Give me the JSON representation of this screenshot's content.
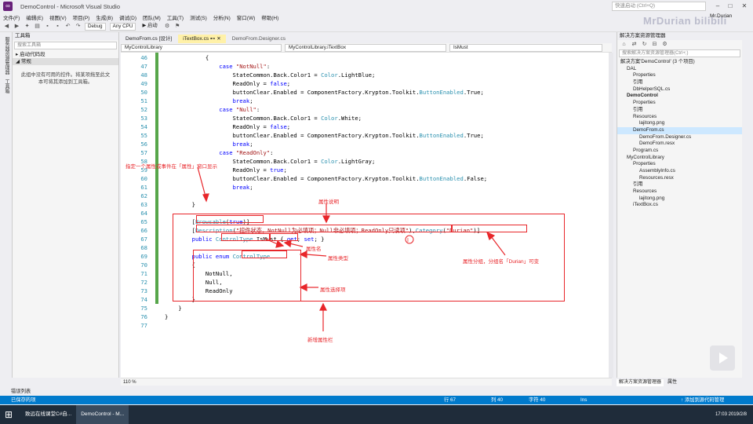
{
  "window": {
    "title": "DemoControl - Microsoft Visual Studio",
    "quick_launch_placeholder": "快速启动 (Ctrl+Q)",
    "user": "Mr.Durian",
    "watermark": "MrDurian bilibili"
  },
  "menu": [
    "文件(F)",
    "编辑(E)",
    "视图(V)",
    "项目(P)",
    "生成(B)",
    "调试(D)",
    "团队(M)",
    "工具(T)",
    "测试(S)",
    "分析(N)",
    "窗口(W)",
    "帮助(H)"
  ],
  "toolbar": {
    "config": "Debug",
    "platform": "Any CPU",
    "start_label": "▶ 启动"
  },
  "left_strip": [
    "服务器资源管理器",
    "工具箱"
  ],
  "toolbox": {
    "title": "工具箱",
    "search_placeholder": "搜索工具箱",
    "groups": [
      "启动代码段",
      "常规"
    ],
    "empty_message": "此组中没有可用的控件。将某项拖至此文本可将其添加到工具箱。"
  },
  "editor": {
    "tabs": [
      "DemoFrom.cs [设计]",
      "iTextBox.cs",
      "DemoFrom.Designer.cs"
    ],
    "active_tab_index": 1,
    "nav": [
      "MyControlLibrary",
      "MyControlLibrary.iTextBox",
      "IsMust"
    ],
    "zoom": "110 %",
    "line_numbers": [
      "46",
      "47",
      "48",
      "49",
      "50",
      "51",
      "52",
      "53",
      "54",
      "55",
      "56",
      "57",
      "58",
      "59",
      "60",
      "61",
      "62",
      "63",
      "64",
      "65",
      "66",
      "67",
      "68",
      "69",
      "70",
      "71",
      "72",
      "73",
      "74",
      "75",
      "76",
      "77"
    ],
    "code": [
      "            {",
      "                case \"NotNull\":",
      "                    StateCommon.Back.Color1 = Color.LightBlue;",
      "                    ReadOnly = false;",
      "                    buttonClear.Enabled = ComponentFactory.Krypton.Toolkit.ButtonEnabled.True;",
      "                    break;",
      "                case \"Null\":",
      "                    StateCommon.Back.Color1 = Color.White;",
      "                    ReadOnly = false;",
      "                    buttonClear.Enabled = ComponentFactory.Krypton.Toolkit.ButtonEnabled.True;",
      "                    break;",
      "                case \"ReadOnly\":",
      "                    StateCommon.Back.Color1 = Color.LightGray;",
      "                    ReadOnly = true;",
      "                    buttonClear.Enabled = ComponentFactory.Krypton.Toolkit.ButtonEnabled.False;",
      "                    break;",
      "            }",
      "        }",
      "",
      "        [Browsable(true)]",
      "        [Description(\"控件状态，NotNull为必填项；Null非必填项；ReadOnly只读项\"),Category(\"Durian\")]",
      "        public ControlType IsMust { get; set; }",
      "",
      "        public enum ControlType",
      "        {",
      "            NotNull,",
      "            Null,",
      "            ReadOnly",
      "        }",
      "    }",
      "}",
      ""
    ]
  },
  "annotations": {
    "browsable": "指定一个属性或事件在「属性」窗口显示",
    "description": "属性说明",
    "name": "属性名",
    "type": "属性类型",
    "category": "属性分组，分组名「Durian」可变",
    "options": "属性选择项",
    "new_bar": "新增属性栏"
  },
  "solution": {
    "title": "解决方案资源管理器",
    "search_placeholder": "搜索解决方案资源管理器(Ctrl+;)",
    "items": [
      {
        "text": "解决方案'DemoControl' (3 个项目)",
        "indent": 0,
        "bold": false
      },
      {
        "text": "DAL",
        "indent": 1,
        "bold": false
      },
      {
        "text": "Properties",
        "indent": 2,
        "bold": false
      },
      {
        "text": "引用",
        "indent": 2,
        "bold": false
      },
      {
        "text": "DbHelperSQL.cs",
        "indent": 2,
        "bold": false
      },
      {
        "text": "DemoControl",
        "indent": 1,
        "bold": true
      },
      {
        "text": "Properties",
        "indent": 2,
        "bold": false
      },
      {
        "text": "引用",
        "indent": 2,
        "bold": false
      },
      {
        "text": "Resources",
        "indent": 2,
        "bold": false
      },
      {
        "text": "lajitong.png",
        "indent": 3,
        "bold": false
      },
      {
        "text": "DemoFrom.cs",
        "indent": 2,
        "bold": false,
        "selected": true
      },
      {
        "text": "DemoFrom.Designer.cs",
        "indent": 3,
        "bold": false
      },
      {
        "text": "DemoFrom.resx",
        "indent": 3,
        "bold": false
      },
      {
        "text": "Program.cs",
        "indent": 2,
        "bold": false
      },
      {
        "text": "MyControlLibrary",
        "indent": 1,
        "bold": false
      },
      {
        "text": "Properties",
        "indent": 2,
        "bold": false
      },
      {
        "text": "AssemblyInfo.cs",
        "indent": 3,
        "bold": false
      },
      {
        "text": "Resources.resx",
        "indent": 3,
        "bold": false
      },
      {
        "text": "引用",
        "indent": 2,
        "bold": false
      },
      {
        "text": "Resources",
        "indent": 2,
        "bold": false
      },
      {
        "text": "lajitong.png",
        "indent": 3,
        "bold": false
      },
      {
        "text": "iTextBox.cs",
        "indent": 2,
        "bold": false
      }
    ],
    "tabs": [
      "解决方案资源管理器",
      "属性"
    ]
  },
  "error_list": "错误列表",
  "status": {
    "left": "已保存的项",
    "line": "行 67",
    "col": "列 40",
    "ch": "字符 40",
    "mode": "Ins",
    "source_control": "↑ 添加到源代码管理"
  },
  "taskbar": {
    "items": [
      "致远在线课堂C#自...",
      "DemoControl - M..."
    ],
    "tray": "17:03 2019/2/8"
  }
}
